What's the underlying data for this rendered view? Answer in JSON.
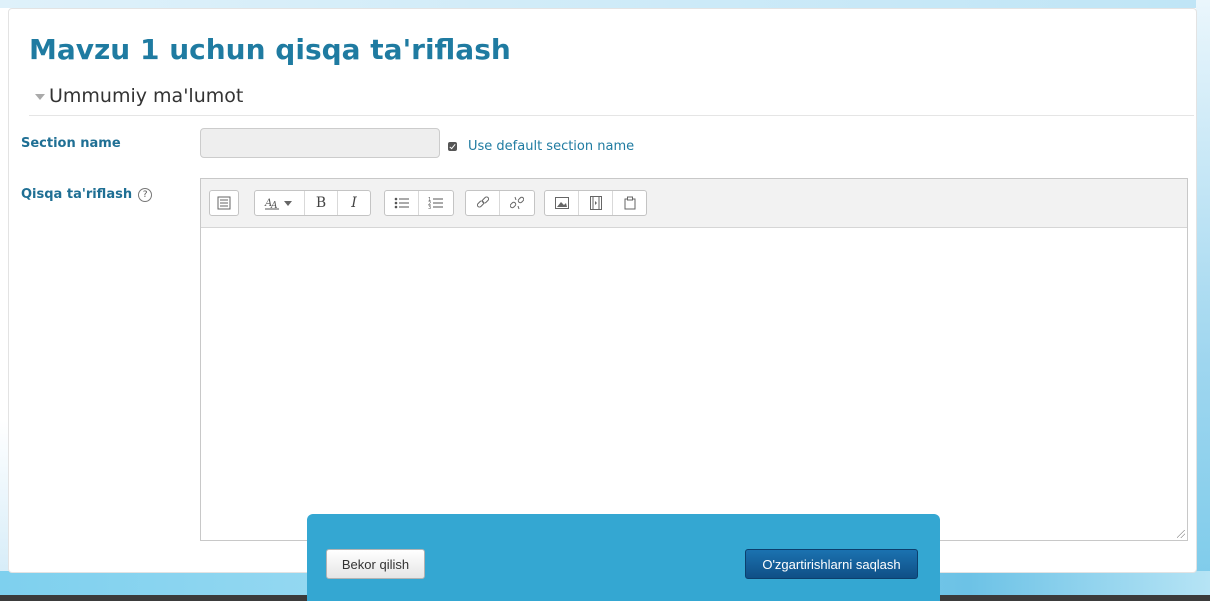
{
  "page": {
    "title": "Mavzu 1 uchun qisqa ta'riflash"
  },
  "section": {
    "title": "Ummumiy ma'lumot"
  },
  "form": {
    "section_name_label": "Section name",
    "section_name_value": "",
    "use_default_checked": true,
    "use_default_label": "Use default section name",
    "summary_label": "Qisqa ta'riflash",
    "help_glyph": "?"
  },
  "toolbar": {
    "groups": [
      [
        "toolbar-toggle-icon"
      ],
      [
        "font-style-dropdown-icon",
        "bold-icon",
        "italic-icon"
      ],
      [
        "bullet-list-icon",
        "numbered-list-icon"
      ],
      [
        "link-icon",
        "unlink-icon"
      ],
      [
        "image-icon",
        "media-icon",
        "paste-icon"
      ]
    ],
    "bold_glyph": "B",
    "italic_glyph": "I"
  },
  "footer": {
    "cancel_label": "Bekor qilish",
    "save_label": "O'zgartirishlarni saqlash"
  },
  "colors": {
    "title": "#1f7ba1",
    "label": "#1f6f94",
    "footer_bg": "#34a7d2",
    "primary_button": "#14609b"
  }
}
